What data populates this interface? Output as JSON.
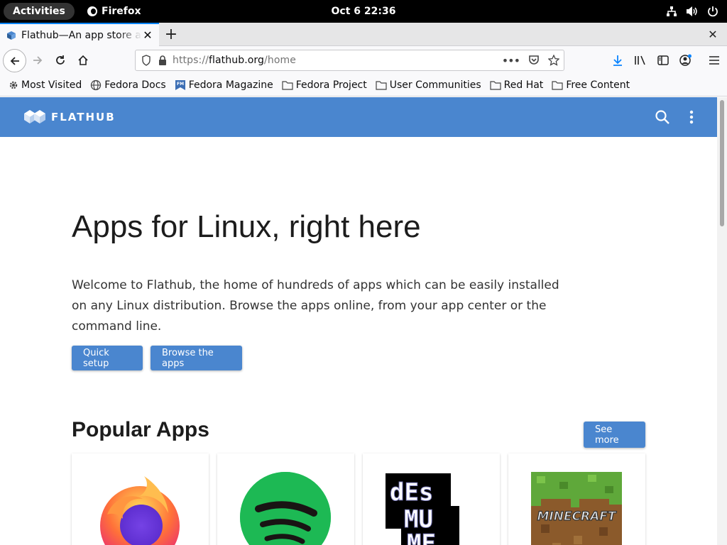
{
  "system": {
    "activities": "Activities",
    "app_name": "Firefox",
    "clock": "Oct 6  22:36"
  },
  "browser": {
    "tab_title": "Flathub—An app store and build service for Linux",
    "url_scheme": "https://",
    "url_host": "flathub.org",
    "url_path": "/home",
    "bookmarks": [
      "Most Visited",
      "Fedora Docs",
      "Fedora Magazine",
      "Fedora Project",
      "User Communities",
      "Red Hat",
      "Free Content"
    ]
  },
  "page": {
    "logo_text": "FLATHUB",
    "hero_title": "Apps for Linux, right here",
    "hero_text": "Welcome to Flathub, the home of hundreds of apps which can be easily installed on any Linux distribution. Browse the apps online, from your app center or the command line.",
    "quick_setup": "Quick setup",
    "browse_apps": "Browse the apps",
    "popular_title": "Popular Apps",
    "see_more": "See more",
    "apps": [
      "firefox-icon",
      "spotify-icon",
      "desmume-icon",
      "minecraft-icon"
    ],
    "minecraft_text": "MINECRAFT",
    "desmume_text": "dEsMuME"
  },
  "colors": {
    "flathub_blue": "#4a86cf",
    "firefox_accent": "#0a84ff"
  }
}
